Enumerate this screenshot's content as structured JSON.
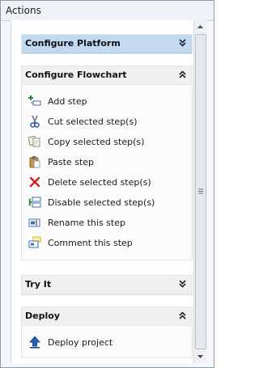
{
  "panel": {
    "title": "Actions"
  },
  "sections": [
    {
      "title": "Configure Platform",
      "state": "collapsed",
      "highlighted": true
    },
    {
      "title": "Configure Flowchart",
      "state": "expanded",
      "items": [
        {
          "label": "Add step",
          "icon": "add-step-icon"
        },
        {
          "label": "Cut selected step(s)",
          "icon": "scissors-icon"
        },
        {
          "label": "Copy selected step(s)",
          "icon": "copy-icon"
        },
        {
          "label": "Paste step",
          "icon": "paste-icon"
        },
        {
          "label": "Delete selected step(s)",
          "icon": "delete-x-icon"
        },
        {
          "label": "Disable selected step(s)",
          "icon": "disable-step-icon"
        },
        {
          "label": "Rename this step",
          "icon": "rename-icon"
        },
        {
          "label": "Comment this step",
          "icon": "comment-icon"
        }
      ]
    },
    {
      "title": "Try It",
      "state": "collapsed"
    },
    {
      "title": "Deploy",
      "state": "expanded",
      "items": [
        {
          "label": "Deploy project",
          "icon": "deploy-arrow-icon"
        }
      ]
    }
  ],
  "colors": {
    "highlight": "#c3d9f1",
    "accent_red": "#d11f1f",
    "accent_blue": "#1f5fb8"
  }
}
